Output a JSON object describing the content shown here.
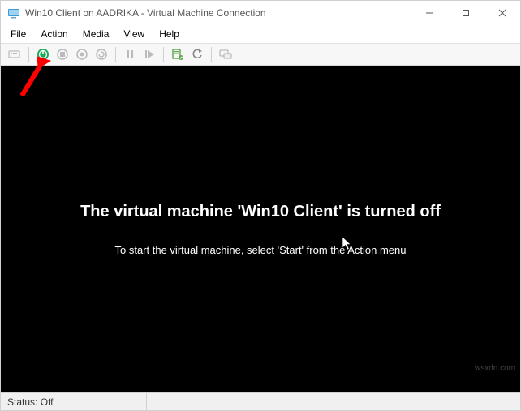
{
  "window": {
    "title": "Win10 Client on AADRIKA - Virtual Machine Connection"
  },
  "menubar": {
    "items": [
      "File",
      "Action",
      "Media",
      "View",
      "Help"
    ]
  },
  "toolbar": {
    "icons": {
      "ctrl_alt_del": "ctrl-alt-del-icon",
      "start": "start-icon",
      "turnoff": "turnoff-icon",
      "shutdown": "shutdown-icon",
      "save": "save-icon",
      "pause": "pause-icon",
      "reset": "reset-icon",
      "checkpoint": "checkpoint-icon",
      "revert": "revert-icon",
      "enhanced": "enhanced-icon"
    }
  },
  "viewport": {
    "headline": "The virtual machine 'Win10 Client' is turned off",
    "subline": "To start the virtual machine, select 'Start' from the Action menu"
  },
  "statusbar": {
    "status": "Status: Off"
  },
  "watermark": "wsxdn.com"
}
